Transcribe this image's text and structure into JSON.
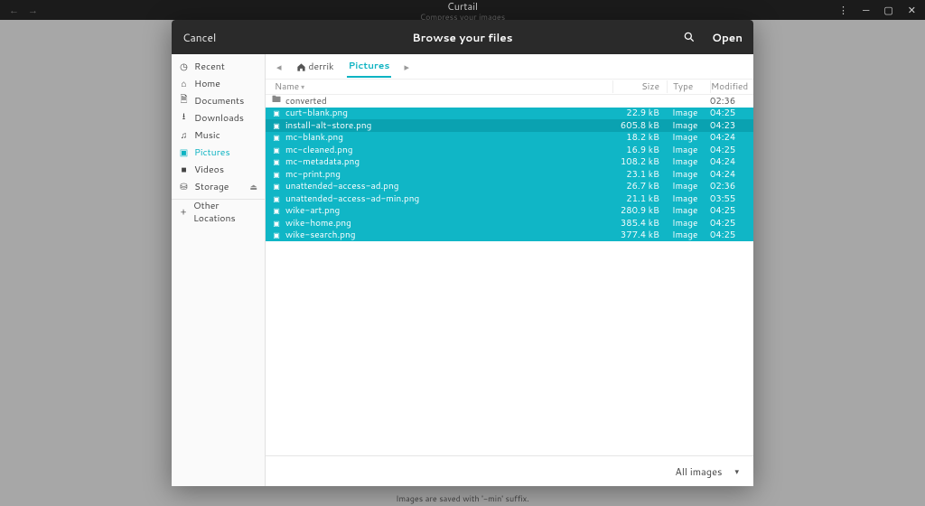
{
  "desktop": {
    "app_name": "Curtail",
    "tagline": "Compress your images"
  },
  "dialog": {
    "cancel": "Cancel",
    "title": "Browse your files",
    "open": "Open"
  },
  "sidebar": {
    "items": [
      {
        "icon": "clock",
        "label": "Recent"
      },
      {
        "icon": "home",
        "label": "Home"
      },
      {
        "icon": "doc",
        "label": "Documents"
      },
      {
        "icon": "down",
        "label": "Downloads"
      },
      {
        "icon": "music",
        "label": "Music"
      },
      {
        "icon": "pic",
        "label": "Pictures",
        "active": true
      },
      {
        "icon": "vid",
        "label": "Videos"
      },
      {
        "icon": "disk",
        "label": "Storage",
        "eject": true
      }
    ],
    "other": "Other Locations"
  },
  "breadcrumb": {
    "home_user": "derrik",
    "current": "Pictures"
  },
  "columns": {
    "name": "Name",
    "size": "Size",
    "type": "Type",
    "modified": "Modified"
  },
  "files": [
    {
      "kind": "folder",
      "name": "converted",
      "size": "",
      "type": "",
      "modified": "02:36",
      "sel": false
    },
    {
      "kind": "img",
      "name": "curt-blank.png",
      "size": "22.9 kB",
      "type": "Image",
      "modified": "04:25",
      "sel": true
    },
    {
      "kind": "img",
      "name": "install-alt-store.png",
      "size": "605.8 kB",
      "type": "Image",
      "modified": "04:23",
      "sel": true,
      "focused": true
    },
    {
      "kind": "img",
      "name": "mc-blank.png",
      "size": "18.2 kB",
      "type": "Image",
      "modified": "04:24",
      "sel": true
    },
    {
      "kind": "img",
      "name": "mc-cleaned.png",
      "size": "16.9 kB",
      "type": "Image",
      "modified": "04:25",
      "sel": true
    },
    {
      "kind": "img",
      "name": "mc-metadata.png",
      "size": "108.2 kB",
      "type": "Image",
      "modified": "04:24",
      "sel": true
    },
    {
      "kind": "img",
      "name": "mc-print.png",
      "size": "23.1 kB",
      "type": "Image",
      "modified": "04:24",
      "sel": true
    },
    {
      "kind": "img",
      "name": "unattended-access-ad.png",
      "size": "26.7 kB",
      "type": "Image",
      "modified": "02:36",
      "sel": true
    },
    {
      "kind": "img",
      "name": "unattended-access-ad-min.png",
      "size": "21.1 kB",
      "type": "Image",
      "modified": "03:55",
      "sel": true
    },
    {
      "kind": "img",
      "name": "wike-art.png",
      "size": "280.9 kB",
      "type": "Image",
      "modified": "04:25",
      "sel": true
    },
    {
      "kind": "img",
      "name": "wike-home.png",
      "size": "385.4 kB",
      "type": "Image",
      "modified": "04:25",
      "sel": true
    },
    {
      "kind": "img",
      "name": "wike-search.png",
      "size": "377.4 kB",
      "type": "Image",
      "modified": "04:25",
      "sel": true
    }
  ],
  "footer": {
    "filter": "All images"
  },
  "bottom_note": "Images are saved with '-min' suffix."
}
